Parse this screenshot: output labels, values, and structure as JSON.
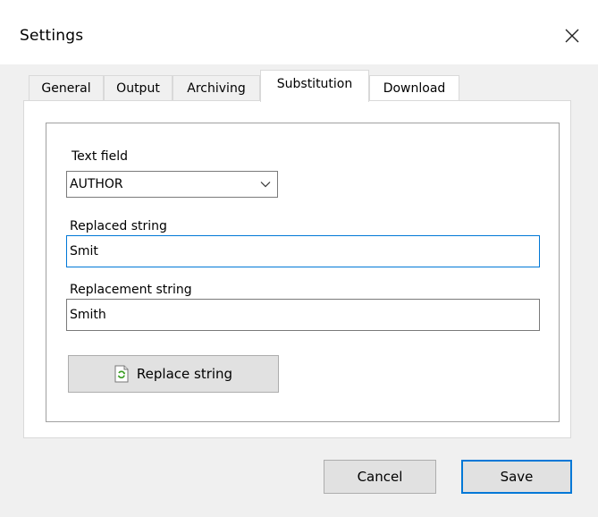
{
  "window": {
    "title": "Settings"
  },
  "tabs": [
    {
      "label": "General"
    },
    {
      "label": "Output"
    },
    {
      "label": "Archiving"
    },
    {
      "label": "Substitution",
      "active": true
    },
    {
      "label": "Download"
    }
  ],
  "substitution": {
    "text_field_label": "Text field",
    "text_field_value": "AUTHOR",
    "replaced_label": "Replaced string",
    "replaced_value": "Smit",
    "replacement_label": "Replacement string",
    "replacement_value": "Smith",
    "replace_button_label": "Replace string"
  },
  "footer": {
    "cancel_label": "Cancel",
    "save_label": "Save"
  },
  "colors": {
    "focus_accent": "#0078d7",
    "icon_green": "#3a9d23"
  },
  "icons": {
    "close": "close-icon",
    "dropdown": "chevron-down-icon",
    "replace": "replace-icon"
  }
}
